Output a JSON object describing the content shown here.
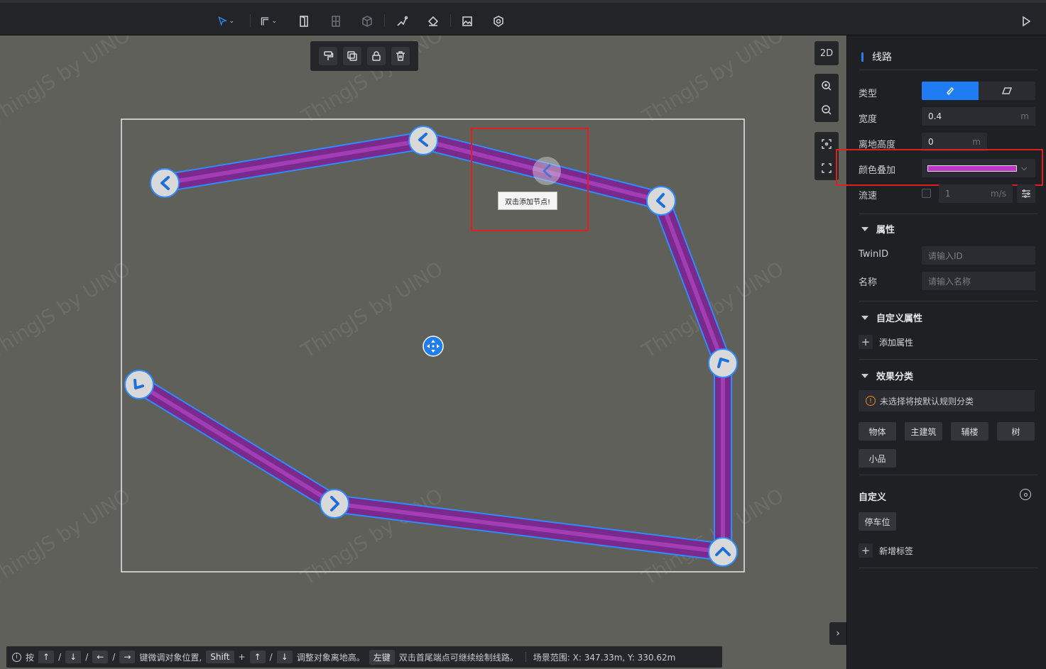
{
  "colors": {
    "accent": "#1f7cf2",
    "line": "#8a2f9a",
    "line_outline": "#2f8cff",
    "highlight": "#e0201e",
    "color_overlay": "#c035c8"
  },
  "toolbar": {
    "icons": [
      "pointer-select-icon",
      "wall-draw-icon",
      "door-icon",
      "window-icon",
      "cube-icon",
      "path-line-icon",
      "paint-bucket-icon",
      "image-icon",
      "model-library-icon",
      "play-icon"
    ]
  },
  "float_toolbar": {
    "icons": [
      "format-brush-icon",
      "copy-icon",
      "lock-icon",
      "delete-icon"
    ]
  },
  "view_tools": {
    "mode_label": "2D"
  },
  "viewport": {
    "watermark": "ThingJS by UINO",
    "tooltip": "双击添加节点!"
  },
  "status_bar": {
    "press": "按",
    "up": "↑",
    "down": "↓",
    "left": "←",
    "right": "→",
    "slash": "/",
    "move_text": "键微调对象位置,",
    "shift": "Shift",
    "plus": "+",
    "height_text": "调整对象离地高。",
    "left_key": "左键",
    "continue_text": "双击首尾端点可继续绘制线路。",
    "range_text": "场景范围: X: 347.33m, Y: 330.62m"
  },
  "panel": {
    "title": "线路",
    "type_label": "类型",
    "width_label": "宽度",
    "width_value": "0.4",
    "width_unit": "m",
    "height_label": "离地高度",
    "height_value": "0",
    "height_unit": "m",
    "color_label": "颜色叠加",
    "flow_label": "流速",
    "flow_value": "1",
    "flow_unit": "m/s",
    "props_title": "属性",
    "twin_label": "TwinID",
    "twin_placeholder": "请输入ID",
    "name_label": "名称",
    "name_placeholder": "请输入名称",
    "custom_props_title": "自定义属性",
    "add_prop": "添加属性",
    "effect_title": "效果分类",
    "effect_notice": "未选择将按默认规则分类",
    "effect_chips": [
      "物体",
      "主建筑",
      "辅楼",
      "树",
      "小品"
    ],
    "custom_title": "自定义",
    "tag": "停车位",
    "add_tag": "新增标签"
  }
}
